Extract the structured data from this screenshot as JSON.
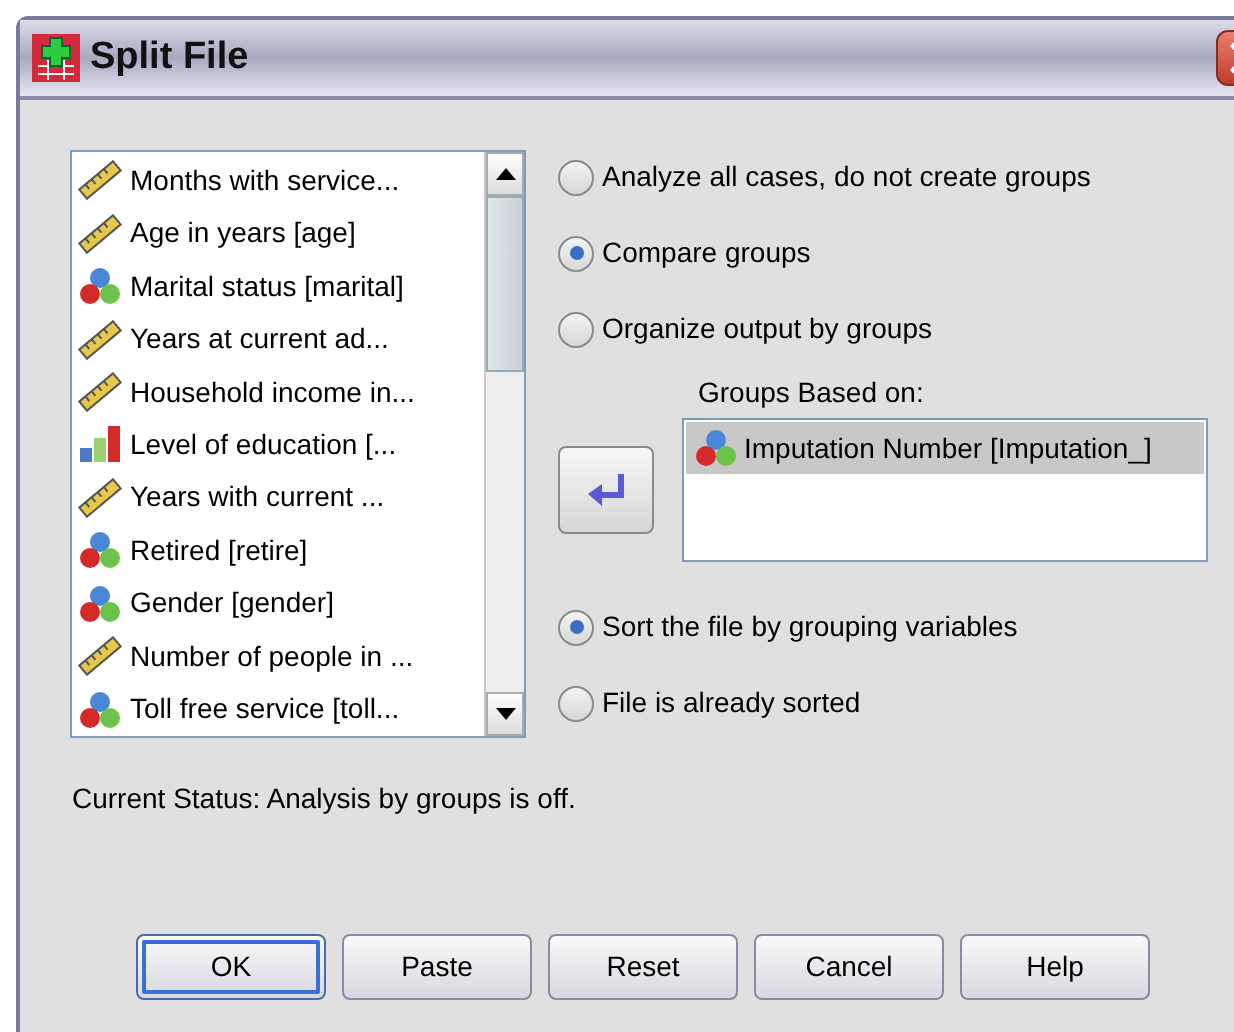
{
  "window": {
    "title": "Split File"
  },
  "variables": [
    {
      "label": "Months with service...",
      "kind": "scale",
      "selected": false
    },
    {
      "label": "Age in years [age]",
      "kind": "scale",
      "selected": false
    },
    {
      "label": "Marital status [marital]",
      "kind": "nominal",
      "selected": false
    },
    {
      "label": "Years at current ad...",
      "kind": "scale",
      "selected": false
    },
    {
      "label": "Household income in...",
      "kind": "scale",
      "selected": false
    },
    {
      "label": "Level of education [...",
      "kind": "ordinal",
      "selected": false
    },
    {
      "label": "Years with current ...",
      "kind": "scale",
      "selected": false
    },
    {
      "label": "Retired [retire]",
      "kind": "nominal",
      "selected": false
    },
    {
      "label": "Gender [gender]",
      "kind": "nominal",
      "selected": false
    },
    {
      "label": "Number of people in ...",
      "kind": "scale",
      "selected": false
    },
    {
      "label": "Toll free service [toll...",
      "kind": "nominal",
      "selected": false
    }
  ],
  "group_options": [
    {
      "label": "Analyze all cases, do not create groups",
      "selected": false
    },
    {
      "label": "Compare groups",
      "selected": true
    },
    {
      "label": "Organize output by groups",
      "selected": false
    }
  ],
  "groups_based_on": {
    "label": "Groups Based on:",
    "items": [
      {
        "label": "Imputation Number [Imputation_]",
        "kind": "nominal",
        "selected": true
      }
    ]
  },
  "sort_options": [
    {
      "label": "Sort the file by grouping variables",
      "selected": true
    },
    {
      "label": "File is already sorted",
      "selected": false
    }
  ],
  "status": "Current Status: Analysis by groups is off.",
  "buttons": [
    {
      "label": "OK",
      "default": true
    },
    {
      "label": "Paste",
      "default": false
    },
    {
      "label": "Reset",
      "default": false
    },
    {
      "label": "Cancel",
      "default": false
    },
    {
      "label": "Help",
      "default": false
    }
  ]
}
